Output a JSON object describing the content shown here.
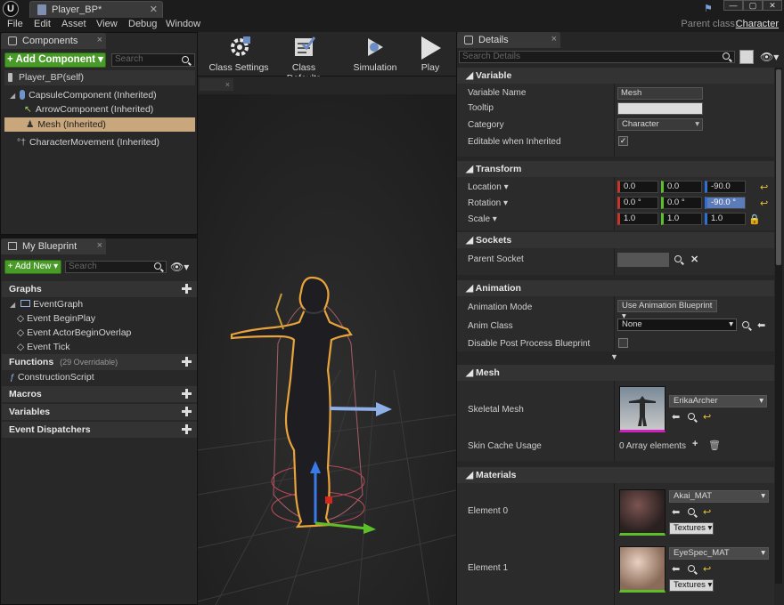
{
  "title_bar": {
    "logo": "U",
    "doc_tab": "Player_BP*",
    "close": "✕"
  },
  "window_buttons": [
    "—",
    "▢",
    "✕"
  ],
  "menu": {
    "items": [
      "File",
      "Edit",
      "Asset",
      "View",
      "Debug",
      "Window"
    ],
    "parent_class_label": "Parent class:",
    "parent_class_value": "Character"
  },
  "components": {
    "tab": "Components",
    "add_button": "+ Add Component ▾",
    "search_placeholder": "Search",
    "self_item": "Player_BP(self)",
    "tree": [
      "CapsuleComponent (Inherited)",
      "ArrowComponent (Inherited)",
      "Mesh (Inherited)",
      "CharacterMovement (Inherited)"
    ]
  },
  "blueprint": {
    "tab": "My Blueprint",
    "add_new": "+ Add New ▾",
    "search_placeholder": "Search",
    "graphs_header": "Graphs",
    "event_graph": "EventGraph",
    "events": [
      "Event BeginPlay",
      "Event ActorBeginOverlap",
      "Event Tick"
    ],
    "functions_header": "Functions",
    "functions_count": "(29 Overridable)",
    "construction_script": "ConstructionScript",
    "macros": "Macros",
    "variables": "Variables",
    "dispatchers": "Event Dispatchers"
  },
  "toolbar": {
    "buttons": [
      "Class Settings",
      "Class Defaults",
      "Simulation",
      "Play"
    ]
  },
  "viewport": {
    "tab_close": "×"
  },
  "details": {
    "tab": "Details",
    "search_placeholder": "Search Details",
    "variable": {
      "header": "Variable",
      "name_label": "Variable Name",
      "name_value": "Mesh",
      "tooltip_label": "Tooltip",
      "category_label": "Category",
      "category_value": "Character",
      "editable_label": "Editable when Inherited"
    },
    "transform": {
      "header": "Transform",
      "location_label": "Location ▾",
      "location": [
        "0.0",
        "0.0",
        "-90.0"
      ],
      "rotation_label": "Rotation ▾",
      "rotation": [
        "0.0 °",
        "0.0 °",
        "-90.0 °"
      ],
      "scale_label": "Scale ▾",
      "scale": [
        "1.0",
        "1.0",
        "1.0"
      ]
    },
    "sockets": {
      "header": "Sockets",
      "parent_socket_label": "Parent Socket"
    },
    "animation": {
      "header": "Animation",
      "mode_label": "Animation Mode",
      "mode_value": "Use Animation Blueprint ▾",
      "class_label": "Anim Class",
      "class_value": "None",
      "disable_label": "Disable Post Process Blueprint"
    },
    "mesh": {
      "header": "Mesh",
      "skeletal_label": "Skeletal Mesh",
      "skeletal_value": "ErikaArcher",
      "skin_cache_label": "Skin Cache Usage",
      "skin_cache_value": "0 Array elements"
    },
    "materials": {
      "header": "Materials",
      "element0_label": "Element 0",
      "element0_value": "Akai_MAT",
      "element0_textures": "Textures ▾",
      "element1_label": "Element 1",
      "element1_value": "EyeSpec_MAT",
      "element1_textures": "Textures ▾"
    }
  }
}
